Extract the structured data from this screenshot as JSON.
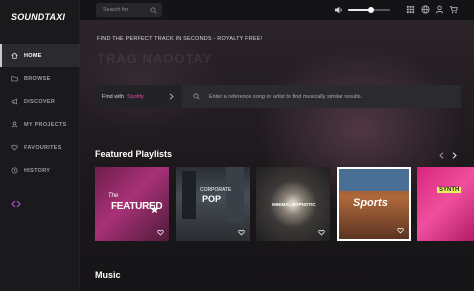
{
  "brand": {
    "logo_text": "SOUNDTAXI"
  },
  "sidebar": {
    "items": [
      {
        "label": "HOME",
        "icon": "home-icon",
        "active": true
      },
      {
        "label": "BROWSE",
        "icon": "folder-icon",
        "active": false
      },
      {
        "label": "DISCOVER",
        "icon": "megaphone-icon",
        "active": false
      },
      {
        "label": "MY PROJECTS",
        "icon": "user-icon",
        "active": false
      },
      {
        "label": "FAVOURITES",
        "icon": "heart-icon",
        "active": false
      },
      {
        "label": "HISTORY",
        "icon": "clock-icon",
        "active": false
      }
    ],
    "collapse_icon": "collapse-arrows-icon"
  },
  "topbar": {
    "search_placeholder": "Search for",
    "volume_level": 0.55,
    "icons": [
      "grid-icon",
      "globe-icon",
      "account-icon",
      "cart-icon"
    ]
  },
  "hero": {
    "tagline": "FIND THE PERFECT TRACK IN SECONDS - ROYALTY FREE!",
    "headline": "TRAG NAOOTAY"
  },
  "find": {
    "prefix": "Find with",
    "service": "Spotify",
    "placeholder": "Enter a reference song or artist to find musically similar results."
  },
  "featured": {
    "title": "Featured Playlists",
    "cards": [
      {
        "name": "Featured",
        "label": "FEATURED",
        "sub": "The"
      },
      {
        "name": "Corporate Pop",
        "label": "CORPORATE",
        "sub": "POP"
      },
      {
        "name": "Minimal Hypnotic",
        "label": "MINIMAL HYPNOTIC",
        "sub": ""
      },
      {
        "name": "Sports",
        "label": "Sports",
        "sub": ""
      },
      {
        "name": "Synth",
        "label": "SYNTH",
        "sub": ""
      }
    ]
  },
  "music": {
    "title": "Music"
  },
  "colors": {
    "accent": "#e0489b",
    "background": "#141416",
    "sidebar": "#1a1a1d"
  }
}
